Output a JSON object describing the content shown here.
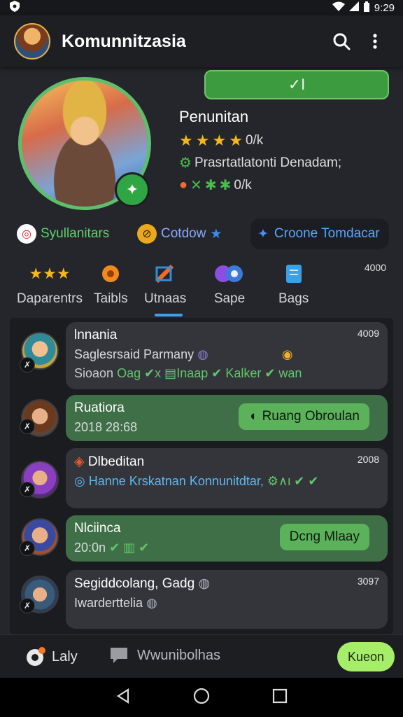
{
  "status": {
    "time": "9:29"
  },
  "app": {
    "title": "Komunnitzasia"
  },
  "profile": {
    "badge_pill": "✓I",
    "name": "Penunitan",
    "stars_value": "0/k",
    "description": "Prasrtatlatonti Denadam;",
    "items_value": "0/k"
  },
  "chips": [
    {
      "label": "Syullanitars"
    },
    {
      "label": "Cotdow"
    },
    {
      "label": "Croone Tomdacar"
    }
  ],
  "tabs": [
    {
      "label": "Daparentrs",
      "icon": "stars-icon"
    },
    {
      "label": "Taibls",
      "icon": "orange-badge-icon"
    },
    {
      "label": "Utnaas",
      "icon": "flag-icon",
      "active": true
    },
    {
      "label": "Sape",
      "icon": "purple-orb-icon"
    },
    {
      "label": "Bags",
      "icon": "book-icon"
    }
  ],
  "tabs_count": "4000",
  "list": [
    {
      "title": "lnnania",
      "subtitle": "Saglesrsaid Parmany",
      "line3_prefix": "Sioaon",
      "line3_tags": "Oag ✔x ▤Inaap ✔ Kalker ✔ wan",
      "stamp": "4009",
      "style": "dark"
    },
    {
      "title": "Ruatiora",
      "subtitle": "2018 28:68",
      "bubble": "Ruang Obroulan",
      "style": "green"
    },
    {
      "title": "Dlbeditan",
      "subtitle": "Hanne Krskatnan Konnunitdtar,",
      "stamp": "2008",
      "style": "dark"
    },
    {
      "title": "Nlciinca",
      "subtitle": "20:0n",
      "bubble": "Dcng Mlaay",
      "style": "green"
    },
    {
      "title": "Segiddcolang, Gadg",
      "subtitle": "Iwarderttelia",
      "stamp": "3097",
      "style": "dark"
    }
  ],
  "bottom": {
    "left_label": "Laly",
    "mid_label": "Wwunibolhas",
    "action_label": "Kueon"
  },
  "colors": {
    "accent_green": "#3f6f47",
    "action_green": "#a6ee6a",
    "bubble_green": "#5bb25b",
    "star_gold": "#f5b81c",
    "link_blue": "#5db9f0"
  }
}
